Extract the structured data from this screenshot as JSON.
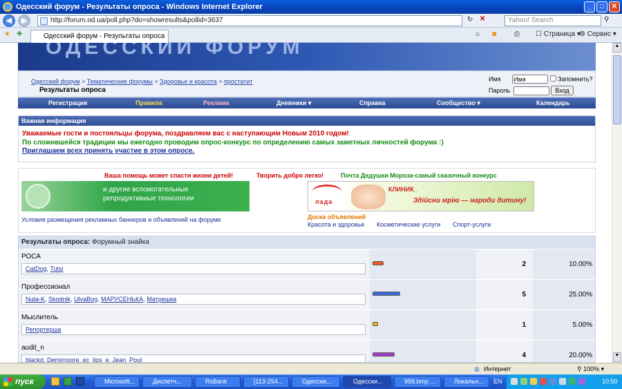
{
  "window": {
    "title": "Одесский форум - Результаты опроса - Windows Internet Explorer"
  },
  "browser": {
    "url": "http://forum.od.ua/poll.php?do=showresults&pollid=3637",
    "search_placeholder": "Yahoo! Search",
    "tab_label": "Одесский форум - Результаты опроса",
    "page_menu": "Страница",
    "tools_menu": "Сервис"
  },
  "breadcrumb": {
    "items": [
      "Одесский форум",
      "Тематические форумы",
      "Здоровье и красота",
      "простатит"
    ],
    "current": "Результаты опроса"
  },
  "login": {
    "name_label": "Имя",
    "name_value": "Имя",
    "remember": "Запомнить?",
    "password_label": "Пароль",
    "submit": "Вход"
  },
  "nav": {
    "items": [
      "Регистрация",
      "Правила",
      "Реклама",
      "Дневники ▾",
      "Справка",
      "Сообщество ▾",
      "Календарь"
    ]
  },
  "notice": {
    "header": "Важная информация",
    "line1": "Уважаемые гости и постояльцы форума, поздравляем вас с наступающим Новым 2010 годом!",
    "line2": "По сложившейся традиции мы ежегодно проводим опрос-конкурс по определению самых заметных личностей форума :)",
    "line3": "Приглашаем всех принять участие в этом опросе."
  },
  "ads": {
    "t1": "Ваша помощь может спасти жизни детей!",
    "t2": "Творить добро легко!",
    "t3": "Почта Дедушки Мороза-самый сказочный конкурс",
    "banner1": "и другие вспомогательные репродуктивные технологии",
    "banner2_name": "КЛИНИК_",
    "banner2_slogan": "Здійсни мрію — народи дитину!",
    "banner2_logo": "лада",
    "conditions": "Условия размещения рекламных баннеров и объявлений на форуме",
    "board_title": "Доска объявлений",
    "board_links": [
      "Красота и здоровье",
      "Косметические услуги",
      "Спорт-услуги"
    ]
  },
  "poll": {
    "title": "Результаты опроса",
    "subtitle": "Форумный знайка",
    "rows": [
      {
        "option": "РОСА",
        "voters": [
          "CatDog",
          "Tutsi"
        ],
        "votes": "2",
        "percent": "10.00%",
        "color": "#f05a1e",
        "fraction": 0.1
      },
      {
        "option": "Профессионал",
        "voters": [
          "Nuta-K",
          "Skodnik",
          "UlvaBog",
          "МАРУСЕНЬКА",
          "Матрешка"
        ],
        "votes": "5",
        "percent": "25.00%",
        "color": "#3a6ad8",
        "fraction": 0.25
      },
      {
        "option": "Мыслитель",
        "voters": [
          "Репортерша"
        ],
        "votes": "1",
        "percent": "5.00%",
        "color": "#f0b800",
        "fraction": 0.05
      },
      {
        "option": "audit_n",
        "voters": [
          "blackd",
          "Demimoore",
          "ec_lips_e",
          "Jean_Poul"
        ],
        "votes": "4",
        "percent": "20.00%",
        "color": "#a43cc8",
        "fraction": 0.2
      }
    ]
  },
  "status": {
    "zone": "Интернет",
    "zoom": "100%"
  },
  "taskbar": {
    "start": "пуск",
    "buttons": [
      "Microsoft...",
      "Диспетч...",
      "RsBank",
      "[113-254...",
      "Одесски...",
      "Одесски...",
      "999.bmp ...",
      "Локальн..."
    ],
    "lang": "EN",
    "clock": "10:50"
  }
}
